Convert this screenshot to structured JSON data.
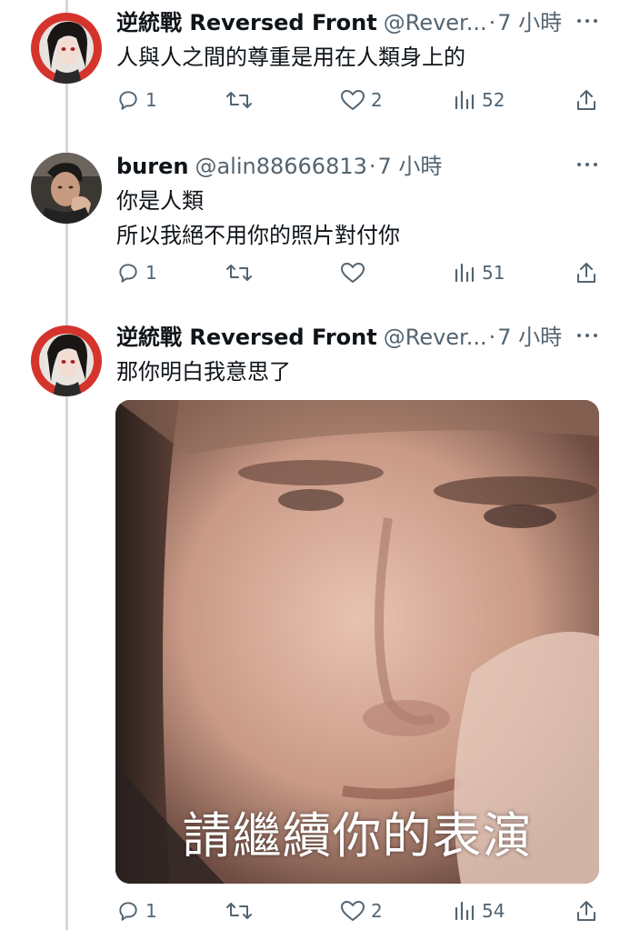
{
  "tweets": [
    {
      "name": "逆統戰 Reversed Front",
      "handle": "@Rever...",
      "dot": "·",
      "time": "7 小時",
      "lines": [
        "人與人之間的尊重是用在人類身上的"
      ],
      "replies": "1",
      "retweets": "",
      "likes": "2",
      "views": "52"
    },
    {
      "name": "buren",
      "handle": "@alin88666813",
      "dot": "·",
      "time": "7 小時",
      "lines": [
        "你是人類",
        "所以我絕不用你的照片對付你"
      ],
      "replies": "1",
      "retweets": "",
      "likes": "",
      "views": "51"
    },
    {
      "name": "逆統戰 Reversed Front",
      "handle": "@Rever...",
      "dot": "·",
      "time": "7 小時",
      "lines": [
        "那你明白我意思了"
      ],
      "media_caption": "請繼續你的表演",
      "replies": "1",
      "retweets": "",
      "likes": "2",
      "views": "54"
    }
  ],
  "icons": {
    "reply": "reply-icon",
    "retweet": "retweet-icon",
    "like": "heart-icon",
    "views": "views-icon",
    "share": "share-icon",
    "more": "more-icon"
  },
  "colors": {
    "text": "#0f1419",
    "secondary": "#536471",
    "thread_line": "#cfd9de"
  }
}
